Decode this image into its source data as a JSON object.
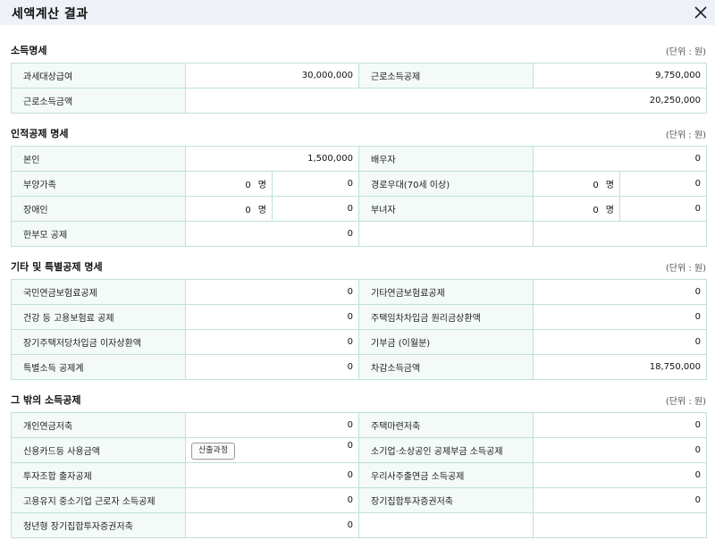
{
  "window": {
    "title": "세액계산 결과"
  },
  "unit_label": "(단위 : 원)",
  "sections": {
    "income": {
      "title": "소득명세",
      "rows": [
        {
          "l1": "과세대상급여",
          "v1": "30,000,000",
          "l2": "근로소득공제",
          "v2": "9,750,000"
        },
        {
          "l1": "근로소득금액",
          "v1": "20,250,000"
        }
      ]
    },
    "personal": {
      "title": "인적공제 명세",
      "count_unit": "명",
      "rows": [
        {
          "l1": "본인",
          "v1": "1,500,000",
          "l2": "배우자",
          "v2": "0"
        },
        {
          "l1": "부양가족",
          "c1": "0",
          "v1": "0",
          "l2": "경로우대(70세 이상)",
          "c2": "0",
          "v2": "0"
        },
        {
          "l1": "장애인",
          "c1": "0",
          "v1": "0",
          "l2": "부녀자",
          "c2": "0",
          "v2": "0"
        },
        {
          "l1": "한부모 공제",
          "v1": "0"
        }
      ]
    },
    "other": {
      "title": "기타 및 특별공제 명세",
      "rows": [
        {
          "l1": "국민연금보험료공제",
          "v1": "0",
          "l2": "기타연금보험료공제",
          "v2": "0"
        },
        {
          "l1": "건강 등 고용보험료 공제",
          "v1": "0",
          "l2": "주택임차차입금 원리금상환액",
          "v2": "0"
        },
        {
          "l1": "장기주택저당차입금 이자상환액",
          "v1": "0",
          "l2": "기부금 (이월분)",
          "v2": "0"
        },
        {
          "l1": "특별소득 공제계",
          "v1": "0",
          "l2": "차감소득금액",
          "v2": "18,750,000"
        }
      ]
    },
    "extra": {
      "title": "그 밖의 소득공제",
      "calc_button": "산출과정",
      "rows": [
        {
          "l1": "개인연금저축",
          "v1": "0",
          "l2": "주택마련저축",
          "v2": "0"
        },
        {
          "l1": "신용카드등 사용금액",
          "v1": "0",
          "l2": "소기업·소상공인 공제부금 소득공제",
          "v2": "0"
        },
        {
          "l1": "투자조합 출자공제",
          "v1": "0",
          "l2": "우리사주출연금 소득공제",
          "v2": "0"
        },
        {
          "l1": "고용유지 중소기업 근로자 소득공제",
          "v1": "0",
          "l2": "장기집합투자증권저축",
          "v2": "0"
        },
        {
          "l1": "청년형 장기집합투자증권저축",
          "v1": "0"
        }
      ]
    }
  }
}
